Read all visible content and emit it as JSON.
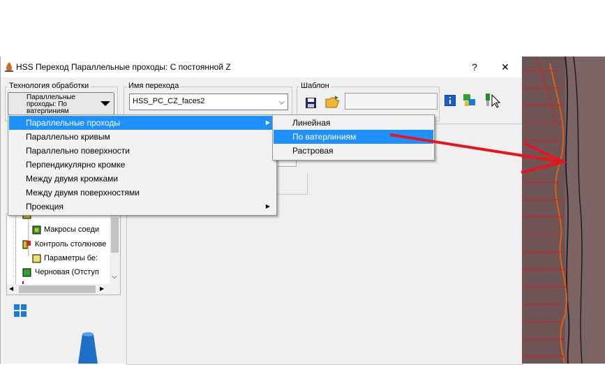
{
  "window": {
    "title": "HSS Переход Параллельные проходы: С постоянной Z",
    "help_label": "?",
    "close_label": "✕"
  },
  "technology": {
    "label": "Технология обработки",
    "value": "Параллельные проходы: По ватерлиниям"
  },
  "operation_name": {
    "label": "Имя перехода",
    "value": "HSS_PC_CZ_faces2",
    "arrow": "⌵"
  },
  "template": {
    "label": "Шаблон",
    "value": ""
  },
  "menu": {
    "items": [
      {
        "label": "Параллельные проходы",
        "has_submenu": true
      },
      {
        "label": "Параллельно кривым",
        "has_submenu": false
      },
      {
        "label": "Параллельно поверхности",
        "has_submenu": false
      },
      {
        "label": "Перпендикулярно кромке",
        "has_submenu": false
      },
      {
        "label": "Между двумя кромками",
        "has_submenu": false
      },
      {
        "label": "Между двумя поверхностями",
        "has_submenu": false
      },
      {
        "label": "Проекция",
        "has_submenu": true
      }
    ],
    "arrow": "▶"
  },
  "submenu": {
    "items": [
      {
        "label": "Линейная"
      },
      {
        "label": "По ватерлиниям"
      },
      {
        "label": "Растровая"
      }
    ]
  },
  "tree": {
    "items": [
      {
        "label": "Макросы соеди"
      },
      {
        "label": "Контроль столкнове"
      },
      {
        "label": "Параметры бе:"
      },
      {
        "label": "Черновая (Отступ"
      }
    ],
    "scroll_left": "◀",
    "scroll_right": "▶",
    "scroll_down": "⌵"
  },
  "colors": {
    "highlight": "#1e90ff",
    "annotation_arrow": "#e8141e",
    "viewport_bg": "#6e5555"
  }
}
